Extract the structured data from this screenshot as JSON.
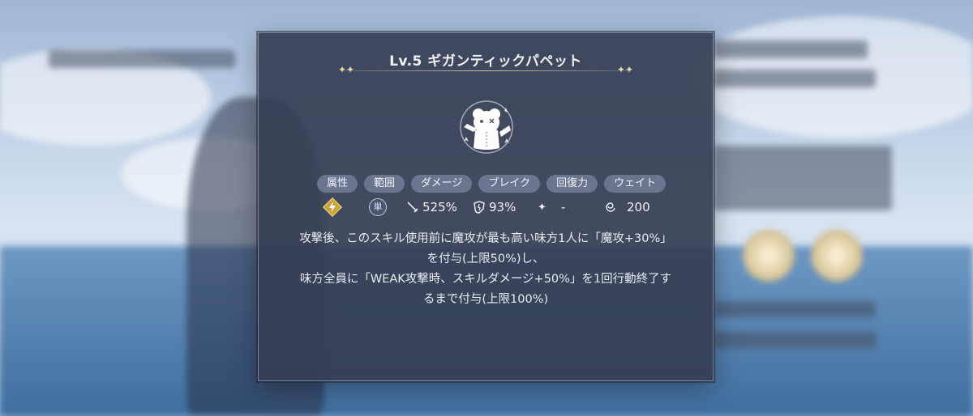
{
  "dialog": {
    "title": "Lv.5 ギガンティックパペット",
    "skill_icon": "puppet-icon"
  },
  "stats": {
    "headers": [
      "属性",
      "範囲",
      "ダメージ",
      "ブレイク",
      "回復力",
      "ウェイト"
    ],
    "element_icon": "lightning-icon",
    "range": "単",
    "damage": "525%",
    "break": "93%",
    "heal": "-",
    "wait": "200"
  },
  "description": [
    "攻撃後、このスキル使用前に魔攻が最も高い味方1人に「魔攻+30%」",
    "を付与(上限50%)し、",
    "味方全員に「WEAK攻撃時、スキルダメージ+50%」を1回行動終了す",
    "るまで付与(上限100%)"
  ],
  "colors": {
    "panel": "#363e54",
    "chip": "#6c7590",
    "accent_gold": "#e6d9a8"
  }
}
